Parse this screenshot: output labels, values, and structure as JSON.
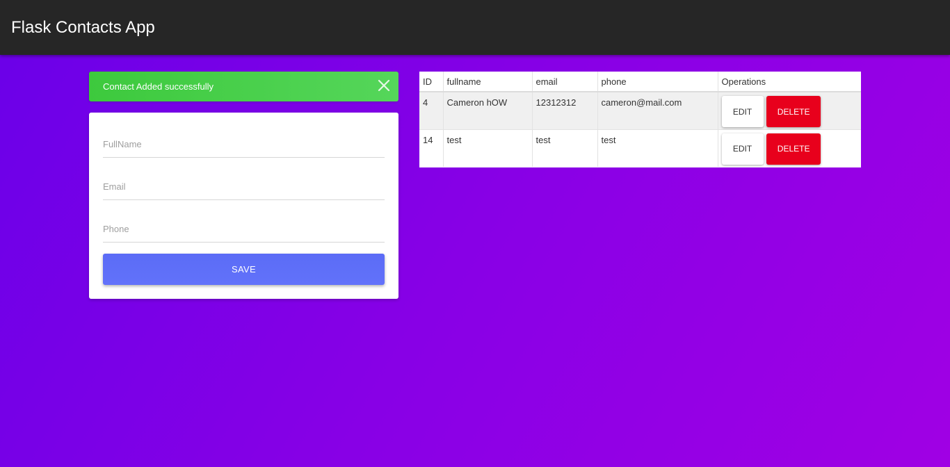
{
  "app": {
    "title": "Flask Contacts App"
  },
  "alert": {
    "message": "Contact Added successfully",
    "close_icon": "close-icon",
    "color": "#46cf4b"
  },
  "form": {
    "fullname_placeholder": "FullName",
    "fullname_value": "",
    "email_placeholder": "Email",
    "email_value": "",
    "phone_placeholder": "Phone",
    "phone_value": "",
    "save_label": "SAVE",
    "save_color": "#5f6ff8"
  },
  "table": {
    "headers": [
      "ID",
      "fullname",
      "email",
      "phone",
      "Operations"
    ],
    "rows": [
      {
        "id": "4",
        "fullname": "Cameron hOW",
        "email": "12312312",
        "phone": "cameron@mail.com",
        "edit_label": "EDIT",
        "delete_label": "DELETE"
      },
      {
        "id": "14",
        "fullname": "test",
        "email": "test",
        "phone": "test",
        "edit_label": "EDIT",
        "delete_label": "DELETE"
      }
    ],
    "delete_color": "#e8001c"
  },
  "colors": {
    "navbar": "#262626",
    "background_start": "#6a00e8",
    "background_end": "#a000e4"
  }
}
